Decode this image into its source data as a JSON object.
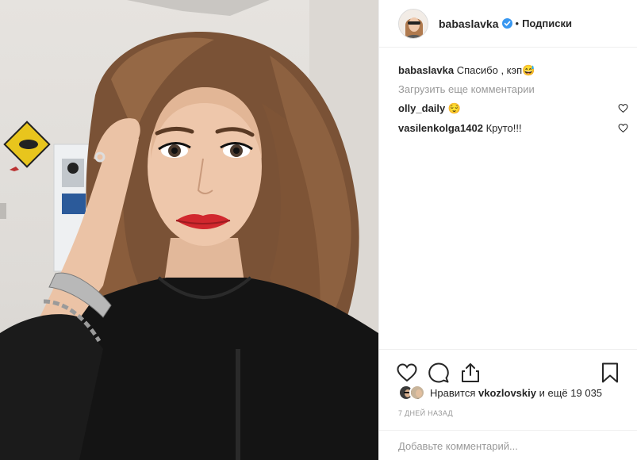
{
  "post": {
    "photo_icon": "selfie-photo",
    "author": "babaslavka",
    "separator": "•",
    "follow_label": "Подписки"
  },
  "comments": {
    "caption": {
      "user": "babaslavka",
      "text": "Спасибо , кэп😅"
    },
    "load_more": "Загрузить еще комментарии",
    "items": [
      {
        "user": "olly_daily",
        "text": "😌"
      },
      {
        "user": "vasilenkolga1402",
        "text": "Круто!!!"
      }
    ]
  },
  "actions": {
    "like_icon": "heart-icon",
    "comment_icon": "comment-icon",
    "share_icon": "share-icon",
    "save_icon": "bookmark-icon"
  },
  "likes": {
    "prefix": "Нравится",
    "user": "vkozlovskiy",
    "suffix": "и ещё 19 035"
  },
  "timestamp": "7 ДНЕЙ НАЗАД",
  "add_comment": {
    "placeholder": "Добавьте комментарий..."
  },
  "colors": {
    "text": "#262626",
    "muted": "#999999",
    "verified": "#3897f0",
    "border": "#efefef",
    "lips": "#d1282e"
  }
}
